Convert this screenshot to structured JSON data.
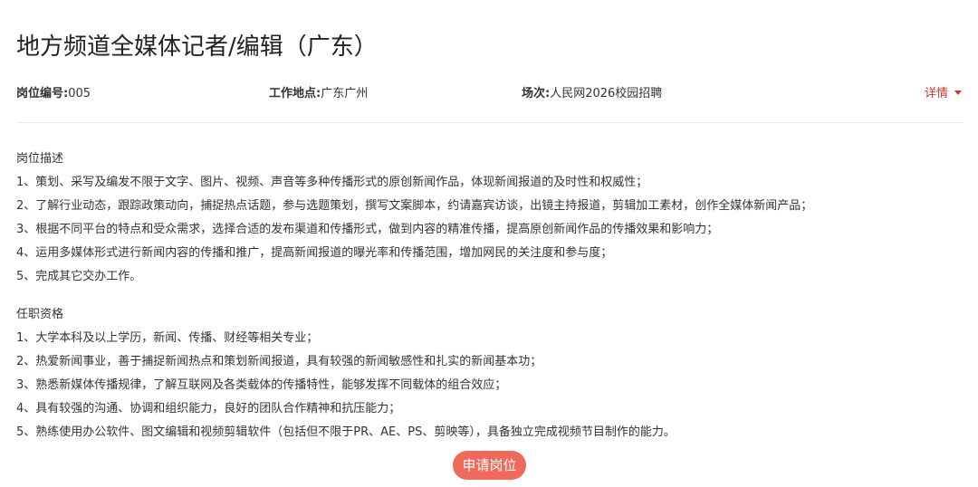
{
  "job": {
    "title": "地方频道全媒体记者/编辑（广东）",
    "id_label": "岗位编号:",
    "id_value": "005",
    "location_label": "工作地点:",
    "location_value": "广东广州",
    "session_label": "场次:",
    "session_value": "人民网2026校园招聘",
    "detail_link": "详情"
  },
  "description": {
    "heading": "岗位描述",
    "items": [
      "1、策划、采写及编发不限于文字、图片、视频、声音等多种传播形式的原创新闻作品，体现新闻报道的及时性和权威性；",
      "2、了解行业动态，跟踪政策动向，捕捉热点话题，参与选题策划，撰写文案脚本，约请嘉宾访谈，出镜主持报道，剪辑加工素材，创作全媒体新闻产品；",
      "3、根据不同平台的特点和受众需求，选择合适的发布渠道和传播形式，做到内容的精准传播，提高原创新闻作品的传播效果和影响力；",
      "4、运用多媒体形式进行新闻内容的传播和推广，提高新闻报道的曝光率和传播范围，增加网民的关注度和参与度；",
      "5、完成其它交办工作。"
    ]
  },
  "requirements": {
    "heading": "任职资格",
    "items": [
      "1、大学本科及以上学历，新闻、传播、财经等相关专业；",
      "2、热爱新闻事业，善于捕捉新闻热点和策划新闻报道，具有较强的新闻敏感性和扎实的新闻基本功；",
      "3、熟悉新媒体传播规律，了解互联网及各类载体的传播特性，能够发挥不同载体的组合效应；",
      "4、具有较强的沟通、协调和组织能力，良好的团队合作精神和抗压能力；",
      "5、熟练使用办公软件、图文编辑和视频剪辑软件（包括但不限于PR、AE、PS、剪映等），具备独立完成视频节目制作的能力。"
    ]
  },
  "apply_button": "申请岗位",
  "colors": {
    "accent": "#c9342b",
    "button": "#ef6a5b",
    "text": "#333333",
    "divider": "#ececec"
  }
}
